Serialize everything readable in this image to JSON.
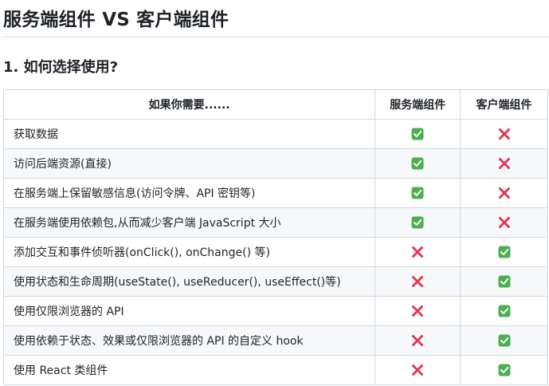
{
  "title": "服务端组件 VS 客户端组件",
  "section_heading": "1. 如何选择使用?",
  "table": {
    "headers": [
      "如果你需要......",
      "服务端组件",
      "客户端组件"
    ],
    "rows": [
      {
        "need": "获取数据",
        "server": "check",
        "client": "cross"
      },
      {
        "need": "访问后端资源(直接)",
        "server": "check",
        "client": "cross"
      },
      {
        "need": "在服务端上保留敏感信息(访问令牌、API 密钥等)",
        "server": "check",
        "client": "cross"
      },
      {
        "need": "在服务端使用依赖包,从而减少客户端 JavaScript 大小",
        "server": "check",
        "client": "cross"
      },
      {
        "need": "添加交互和事件侦听器(onClick(), onChange() 等)",
        "server": "cross",
        "client": "check"
      },
      {
        "need": "使用状态和生命周期(useState(), useReducer(), useEffect()等)",
        "server": "cross",
        "client": "check"
      },
      {
        "need": "使用仅限浏览器的 API",
        "server": "cross",
        "client": "check"
      },
      {
        "need": "使用依赖于状态、效果或仅限浏览器的 API 的自定义 hook",
        "server": "cross",
        "client": "check"
      },
      {
        "need": "使用 React 类组件",
        "server": "cross",
        "client": "check"
      }
    ]
  },
  "icons": {
    "check": "check-mark-icon",
    "cross": "cross-mark-icon"
  },
  "colors": {
    "check": "#4caf50",
    "cross": "#e23a55"
  }
}
